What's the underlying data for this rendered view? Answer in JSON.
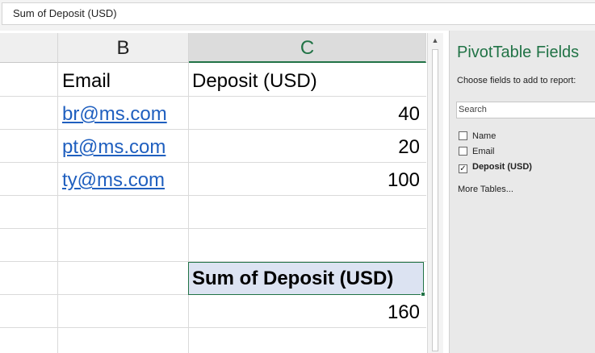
{
  "formula_bar": {
    "value": "Sum of Deposit (USD)"
  },
  "columns": [
    {
      "label": "",
      "selected": false
    },
    {
      "label": "B",
      "selected": false
    },
    {
      "label": "C",
      "selected": true
    }
  ],
  "rows": [
    {
      "email": "Email",
      "deposit": "Deposit (USD)"
    },
    {
      "email": "br@ms.com",
      "deposit": "40"
    },
    {
      "email": "pt@ms.com",
      "deposit": "20"
    },
    {
      "email": "ty@ms.com",
      "deposit": "100"
    }
  ],
  "pivot": {
    "header": "Sum of Deposit (USD)",
    "total": "160"
  },
  "pane": {
    "title": "PivotTable Fields",
    "subtitle": "Choose fields to add to report:",
    "search_placeholder": "Search",
    "fields": [
      {
        "label": "Name",
        "checked": false
      },
      {
        "label": "Email",
        "checked": false
      },
      {
        "label": "Deposit (USD)",
        "checked": true
      }
    ],
    "more_tables": "More Tables..."
  },
  "colors": {
    "accent": "#217346",
    "link": "#1f5fbf",
    "pivot_header_bg": "#dce3f2"
  }
}
